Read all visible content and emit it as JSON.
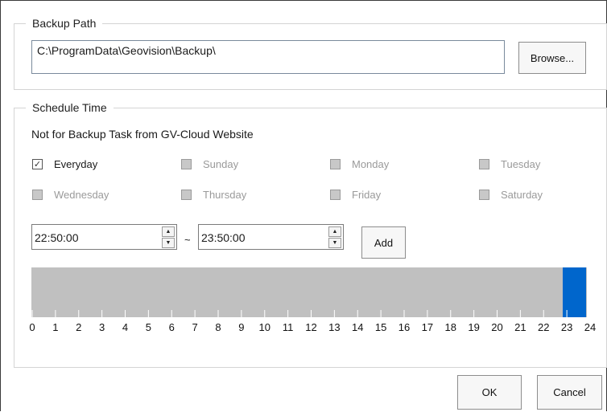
{
  "backup_path": {
    "legend": "Backup Path",
    "value": "C:\\ProgramData\\Geovision\\Backup\\",
    "browse_label": "Browse..."
  },
  "schedule": {
    "legend": "Schedule Time",
    "note": "Not for Backup Task from GV-Cloud Website",
    "days": [
      {
        "label": "Everyday",
        "checked": true
      },
      {
        "label": "Sunday",
        "checked": false
      },
      {
        "label": "Monday",
        "checked": false
      },
      {
        "label": "Tuesday",
        "checked": false
      },
      {
        "label": "Wednesday",
        "checked": false
      },
      {
        "label": "Thursday",
        "checked": false
      },
      {
        "label": "Friday",
        "checked": false
      },
      {
        "label": "Saturday",
        "checked": false
      }
    ],
    "start_time": "22:50:00",
    "separator": "~",
    "end_time": "23:50:00",
    "add_label": "Add",
    "timeline": {
      "hours": [
        "0",
        "1",
        "2",
        "3",
        "4",
        "5",
        "6",
        "7",
        "8",
        "9",
        "10",
        "11",
        "12",
        "13",
        "14",
        "15",
        "16",
        "17",
        "18",
        "19",
        "20",
        "21",
        "22",
        "23",
        "24"
      ],
      "range_start_hour": 22.833,
      "range_end_hour": 23.833,
      "range_color": "#0066cc",
      "bar_color": "#c0c0c0"
    }
  },
  "footer": {
    "ok_label": "OK",
    "cancel_label": "Cancel"
  }
}
